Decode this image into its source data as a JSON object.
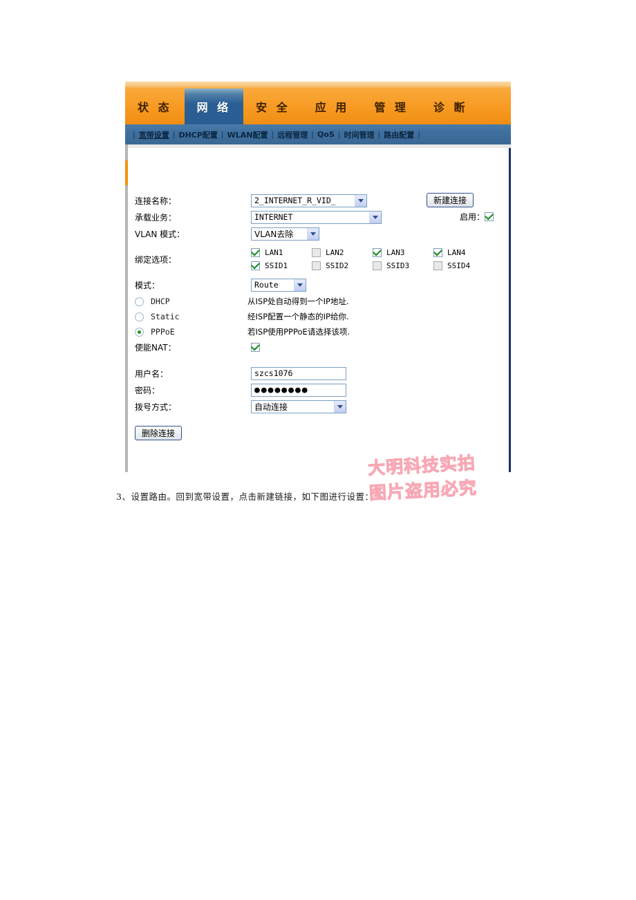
{
  "router": {
    "tabs": [
      {
        "label": "状 态",
        "active": false
      },
      {
        "label": "网 络",
        "active": true
      },
      {
        "label": "安 全",
        "active": false
      },
      {
        "label": "应 用",
        "active": false
      },
      {
        "label": "管 理",
        "active": false
      },
      {
        "label": "诊 断",
        "active": false
      }
    ],
    "subnav": [
      {
        "label": "宽带设置",
        "active": true
      },
      {
        "label": "DHCP配置",
        "active": false
      },
      {
        "label": "WLAN配置",
        "active": false
      },
      {
        "label": "远程管理",
        "active": false
      },
      {
        "label": "QoS",
        "active": false
      },
      {
        "label": "时间管理",
        "active": false
      },
      {
        "label": "路由配置",
        "active": false
      }
    ],
    "form": {
      "conn_name_label": "连接名称：",
      "conn_name_value": "2_INTERNET_R_VID_",
      "new_conn_button": "新建连接",
      "bearer_label": "承载业务：",
      "bearer_value": "INTERNET",
      "enable_label": "启用：",
      "enable_checked": true,
      "vlan_label": "VLAN 模式：",
      "vlan_value": "VLAN去除",
      "bind_label": "绑定选项：",
      "bind_options": [
        {
          "name": "LAN1",
          "checked": true
        },
        {
          "name": "LAN2",
          "checked": false
        },
        {
          "name": "LAN3",
          "checked": true
        },
        {
          "name": "LAN4",
          "checked": true
        },
        {
          "name": "SSID1",
          "checked": true
        },
        {
          "name": "SSID2",
          "checked": false
        },
        {
          "name": "SSID3",
          "checked": false
        },
        {
          "name": "SSID4",
          "checked": false
        }
      ],
      "mode_label": "模式：",
      "mode_value": "Route",
      "wan_types": [
        {
          "name": "DHCP",
          "selected": false,
          "desc": "从ISP处自动得到一个IP地址."
        },
        {
          "name": "Static",
          "selected": false,
          "desc": "经ISP配置一个静态的IP给你."
        },
        {
          "name": "PPPoE",
          "selected": true,
          "desc": "若ISP使用PPPoE请选择该项."
        }
      ],
      "nat_label": "使能NAT：",
      "nat_checked": true,
      "username_label": "用户名：",
      "username_value": "szcs1076",
      "password_label": "密码：",
      "password_value": "●●●●●●●●",
      "dial_label": "拨号方式：",
      "dial_value": "自动连接",
      "delete_button": "删除连接"
    },
    "watermark": {
      "line1": "大明科技实拍",
      "line2": "图片盗用必究"
    }
  },
  "document": {
    "caption": "3、设置路由。回到宽带设置，点击新建链接，如下图进行设置："
  },
  "colors": {
    "tab_orange": "#f79b24",
    "tab_active_blue": "#2b5f94",
    "subnav_blue": "#3f6f9e",
    "accent_orange": "#f5930f",
    "panel_border": "#1b2f66",
    "check_green": "#118a18",
    "watermark_pink": "#f7a8b4"
  }
}
